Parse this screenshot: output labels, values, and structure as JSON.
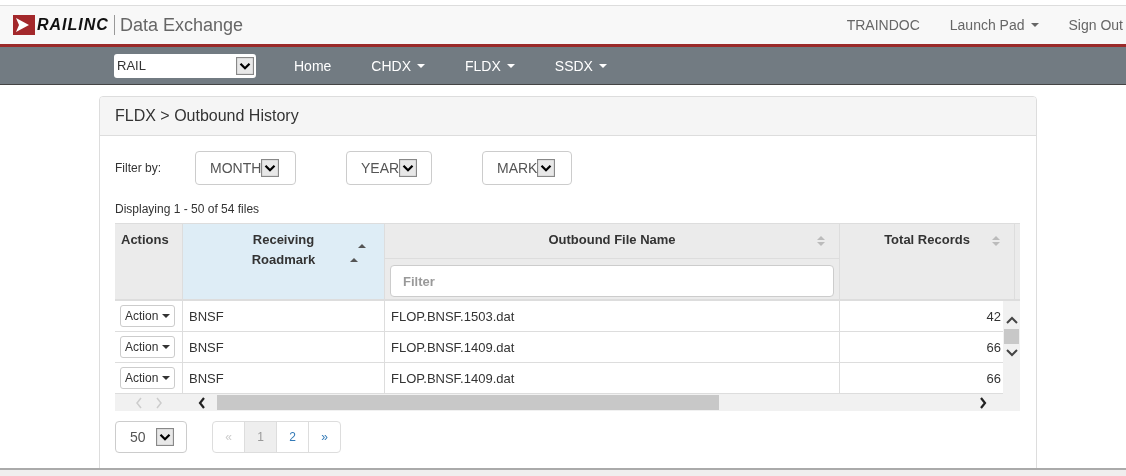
{
  "brand": {
    "logo_text": "RAILINC",
    "app_title": "Data Exchange"
  },
  "user_nav": [
    {
      "label": "TRAINDOC",
      "has_menu": false
    },
    {
      "label": "Launch Pad",
      "has_menu": true
    },
    {
      "label": "Sign Out",
      "has_menu": false
    }
  ],
  "main_nav": {
    "select": "RAIL",
    "items": [
      {
        "label": "Home",
        "has_menu": false
      },
      {
        "label": "CHDX",
        "has_menu": true
      },
      {
        "label": "FLDX",
        "has_menu": true
      },
      {
        "label": "SSDX",
        "has_menu": true
      }
    ]
  },
  "panel": {
    "breadcrumb": "FLDX > Outbound History",
    "filter_label": "Filter by:",
    "filters": [
      "MONTH",
      "YEAR",
      "MARK"
    ],
    "summary": "Displaying 1 - 50 of 54 files",
    "table": {
      "columns": [
        {
          "label": "Actions",
          "sortable": false,
          "sorted": false,
          "filterable": false
        },
        {
          "label": "Receiving Roadmark",
          "sortable": true,
          "sorted": true,
          "filterable": false
        },
        {
          "label": "Outbound File Name",
          "sortable": true,
          "sorted": false,
          "filterable": true
        },
        {
          "label": "Total Records",
          "sortable": true,
          "sorted": false,
          "filterable": false
        }
      ],
      "filter_placeholder": "Filter",
      "rows": [
        {
          "action": "Action",
          "roadmark": "BNSF",
          "file": "FLOP.BNSF.1503.dat",
          "total": "42"
        },
        {
          "action": "Action",
          "roadmark": "BNSF",
          "file": "FLOP.BNSF.1409.dat",
          "total": "66"
        },
        {
          "action": "Action",
          "roadmark": "BNSF",
          "file": "FLOP.BNSF.1409.dat",
          "total": "66"
        }
      ]
    },
    "page_size": "50",
    "pages": [
      {
        "label": "«",
        "selected": false,
        "disabled": true
      },
      {
        "label": "1",
        "selected": true,
        "disabled": false
      },
      {
        "label": "2",
        "selected": false,
        "disabled": false
      },
      {
        "label": "»",
        "selected": false,
        "disabled": false
      }
    ]
  }
}
